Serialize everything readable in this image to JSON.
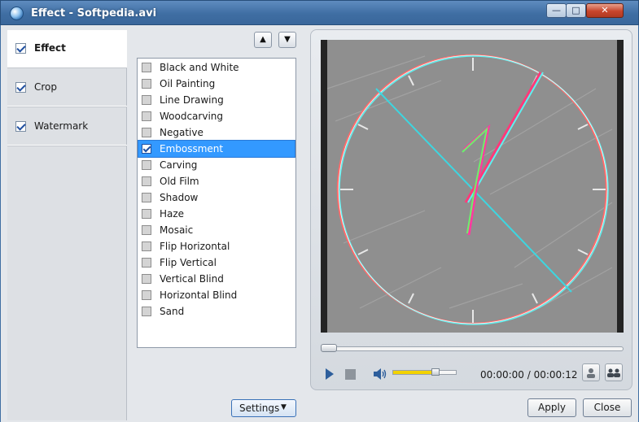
{
  "window": {
    "title": "Effect - Softpedia.avi",
    "controls": {
      "minimize": "—",
      "maximize": "□",
      "close": "✕"
    }
  },
  "categories": [
    {
      "label": "Effect",
      "checked": true,
      "active": true
    },
    {
      "label": "Crop",
      "checked": true,
      "active": false
    },
    {
      "label": "Watermark",
      "checked": true,
      "active": false
    }
  ],
  "order_buttons": {
    "up": "▲",
    "down": "▼"
  },
  "effects": [
    {
      "label": "Black and White",
      "checked": false
    },
    {
      "label": "Oil Painting",
      "checked": false
    },
    {
      "label": "Line Drawing",
      "checked": false
    },
    {
      "label": "Woodcarving",
      "checked": false
    },
    {
      "label": "Negative",
      "checked": false
    },
    {
      "label": "Embossment",
      "checked": true,
      "selected": true
    },
    {
      "label": "Carving",
      "checked": false
    },
    {
      "label": "Old Film",
      "checked": false
    },
    {
      "label": "Shadow",
      "checked": false
    },
    {
      "label": "Haze",
      "checked": false
    },
    {
      "label": "Mosaic",
      "checked": false
    },
    {
      "label": "Flip Horizontal",
      "checked": false
    },
    {
      "label": "Flip Vertical",
      "checked": false
    },
    {
      "label": "Vertical Blind",
      "checked": false
    },
    {
      "label": "Horizontal Blind",
      "checked": false
    },
    {
      "label": "Sand",
      "checked": false
    }
  ],
  "settings_button": {
    "label": "Settings",
    "caret": "▼"
  },
  "player": {
    "time": "00:00:00 / 00:00:12",
    "seek_fraction": 0.0,
    "volume_fraction": 0.7
  },
  "buttons": {
    "apply": "Apply",
    "close": "Close"
  },
  "colors": {
    "selection": "#3399ff",
    "titlebar": "#3f6ea3",
    "volume": "#f2d200"
  }
}
